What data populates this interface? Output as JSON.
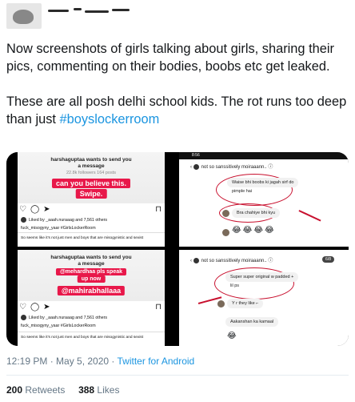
{
  "tweet": {
    "text_part1": "Now screenshots of girls talking about girls, sharing their pics, commenting on their bodies, boobs etc get leaked.\n\nThese are all posh delhi school kids. The rot runs too deep than just ",
    "hashtag": "#boyslockerroom"
  },
  "media": {
    "panel1": {
      "request_line1": "harshaguptaa wants to send you",
      "request_line2": "a message",
      "request_sub": "22.8k followers 164 posts",
      "highlight": "can you believe this.",
      "highlight2": "Swipe.",
      "likes": "Liked by _aaah.nuraaag and 7,561 others",
      "caption": "fuck_misogyny_yaar #GirlsLockerRoom",
      "footer": "So seems like it's not just men and boys that are misogynistic and sexist"
    },
    "panel2": {
      "status_time": "8:56",
      "header": "not so sanssitively moiraaann..",
      "msg1_line1": "Waise bhi boobs ki jagah sirf do",
      "msg1_line2": "pimple hai",
      "msg2": "Bra chahiye bhi kyu",
      "emojis": "😂😂😂😂"
    },
    "panel3": {
      "request_line1": "harshaguptaa wants to send you",
      "request_line2": "a message",
      "request_sub": "22.8k followers 164 posts",
      "tag1": "@mehardhaa pls speak",
      "tag1b": "up now",
      "tag2": "@mahirabhallaaa",
      "likes": "Liked by _aaah.nuraaag and 7,561 others",
      "caption": "fuck_misogyny_yaar #GirlsLockerRoom",
      "footer": "So seems like it's not just men and boys that are misogynistic and sexist"
    },
    "panel4": {
      "header": "not so sanssitively moiraaann..",
      "counter": "6/8",
      "msg1_line1": "Super super original w padded +",
      "msg1_line2": "lil ps",
      "msg2": "Y r they like ⌐",
      "msg3": "Aakanshan ka kamaal",
      "emoji": "😂"
    }
  },
  "meta": {
    "time": "12:19 PM · May 5, 2020 · ",
    "source": "Twitter for Android"
  },
  "stats": {
    "retweets_count": "200",
    "retweets_label": " Retweets",
    "likes_count": "388",
    "likes_label": " Likes"
  },
  "colors": {
    "link": "#1b95e0",
    "meta_gray": "#657786",
    "instagram_pink": "#e8184a",
    "annotation_red": "#c8102e"
  },
  "icons": {
    "like": "heart-icon",
    "comment": "comment-icon",
    "share": "send-icon",
    "save": "bookmark-icon"
  }
}
